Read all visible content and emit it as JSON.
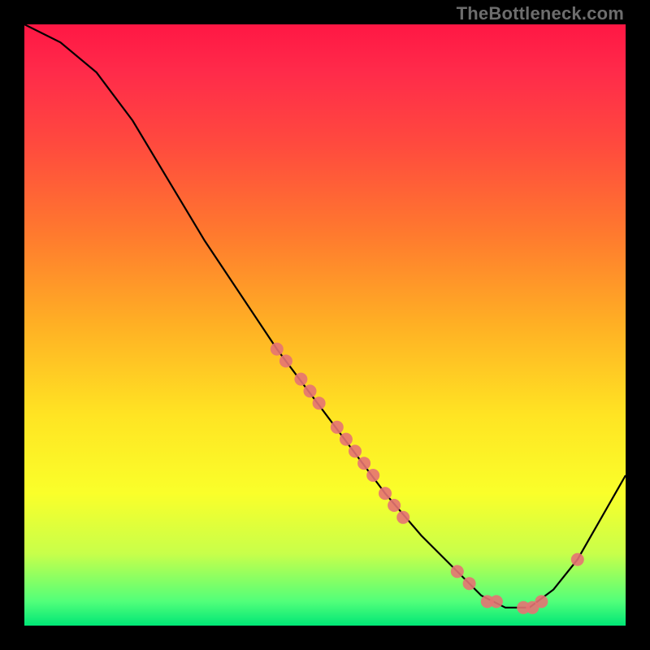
{
  "watermark": {
    "text": "TheBottleneck.com"
  },
  "chart_data": {
    "type": "line",
    "title": "",
    "xlabel": "",
    "ylabel": "",
    "xlim": [
      0,
      1
    ],
    "ylim": [
      0,
      1
    ],
    "background_gradient": [
      "#ff1744",
      "#ffe423",
      "#00e676"
    ],
    "curve_points": [
      [
        0.0,
        1.0
      ],
      [
        0.06,
        0.97
      ],
      [
        0.12,
        0.92
      ],
      [
        0.18,
        0.84
      ],
      [
        0.24,
        0.74
      ],
      [
        0.3,
        0.64
      ],
      [
        0.36,
        0.55
      ],
      [
        0.42,
        0.46
      ],
      [
        0.48,
        0.38
      ],
      [
        0.54,
        0.3
      ],
      [
        0.6,
        0.22
      ],
      [
        0.66,
        0.15
      ],
      [
        0.72,
        0.09
      ],
      [
        0.76,
        0.05
      ],
      [
        0.8,
        0.03
      ],
      [
        0.84,
        0.03
      ],
      [
        0.88,
        0.06
      ],
      [
        0.92,
        0.11
      ],
      [
        0.96,
        0.18
      ],
      [
        1.0,
        0.25
      ]
    ],
    "overlay_points": [
      [
        0.42,
        0.46
      ],
      [
        0.435,
        0.44
      ],
      [
        0.46,
        0.41
      ],
      [
        0.475,
        0.39
      ],
      [
        0.49,
        0.37
      ],
      [
        0.52,
        0.33
      ],
      [
        0.535,
        0.31
      ],
      [
        0.55,
        0.29
      ],
      [
        0.565,
        0.27
      ],
      [
        0.58,
        0.25
      ],
      [
        0.6,
        0.22
      ],
      [
        0.615,
        0.2
      ],
      [
        0.63,
        0.18
      ],
      [
        0.72,
        0.09
      ],
      [
        0.74,
        0.07
      ],
      [
        0.77,
        0.04
      ],
      [
        0.785,
        0.04
      ],
      [
        0.83,
        0.03
      ],
      [
        0.845,
        0.03
      ],
      [
        0.86,
        0.04
      ],
      [
        0.92,
        0.11
      ]
    ]
  }
}
